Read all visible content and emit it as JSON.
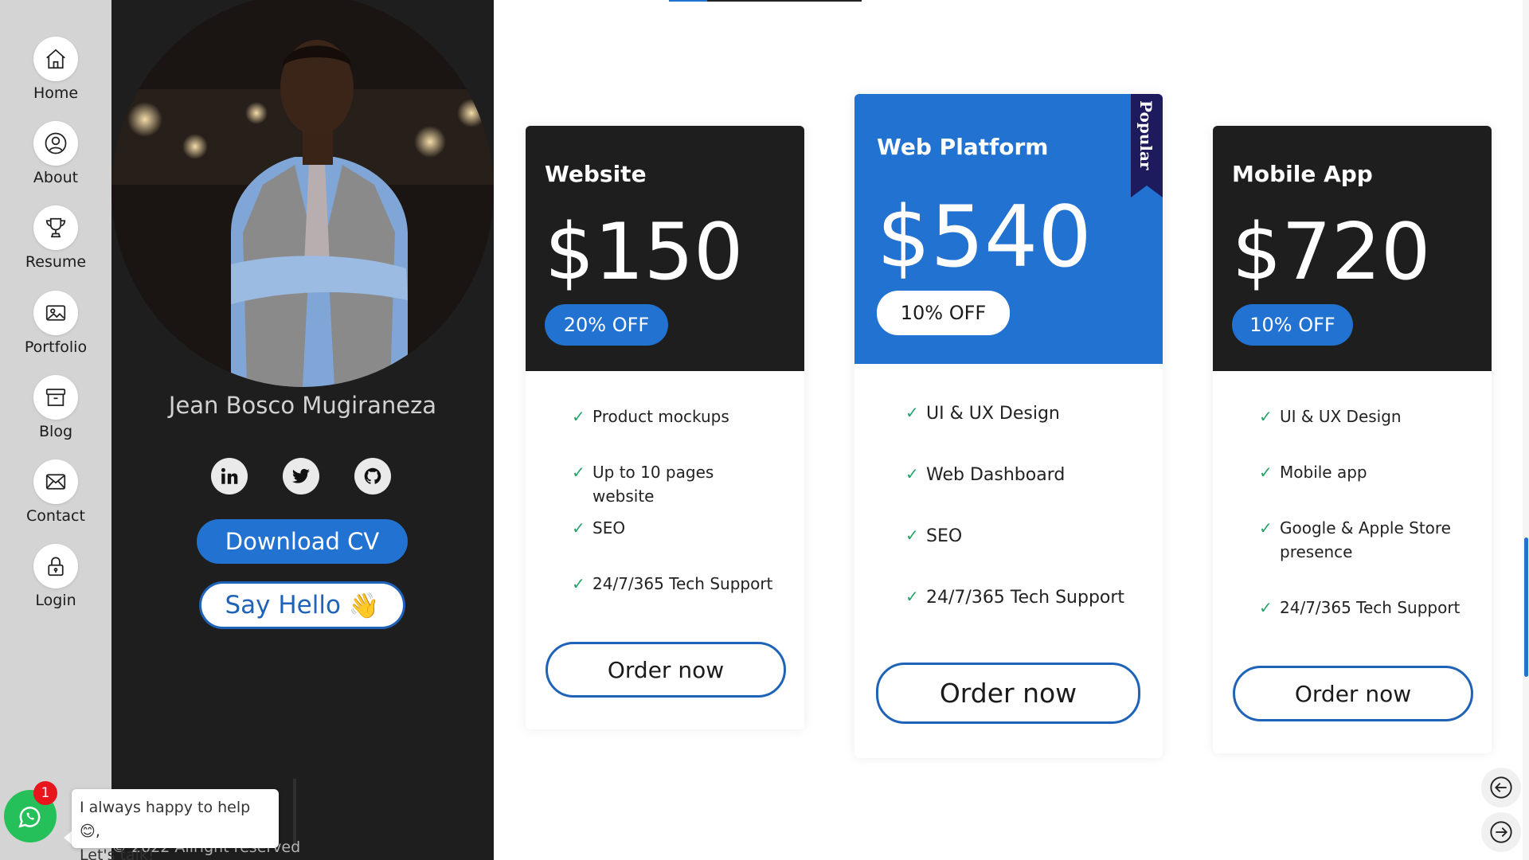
{
  "nav": {
    "items": [
      {
        "label": "Home",
        "icon": "home-icon"
      },
      {
        "label": "About",
        "icon": "user-icon"
      },
      {
        "label": "Resume",
        "icon": "trophy-icon"
      },
      {
        "label": "Portfolio",
        "icon": "image-icon"
      },
      {
        "label": "Blog",
        "icon": "archive-icon"
      },
      {
        "label": "Contact",
        "icon": "mail-icon"
      },
      {
        "label": "Login",
        "icon": "lock-icon"
      }
    ]
  },
  "profile": {
    "name": "Jean Bosco Mugiraneza",
    "socials": [
      {
        "name": "linkedin",
        "icon": "linkedin-icon"
      },
      {
        "name": "twitter",
        "icon": "twitter-icon"
      },
      {
        "name": "github",
        "icon": "github-icon"
      }
    ],
    "download_cv_label": "Download CV",
    "say_hello_label": "Say Hello",
    "say_hello_emoji": "👋",
    "copyright": "© 2022 Allright reserved"
  },
  "pricing": {
    "plans": [
      {
        "title": "Website",
        "price": "$150",
        "discount": "20% OFF",
        "features": [
          "Product mockups",
          "Up to 10 pages website",
          "SEO",
          "24/7/365 Tech Support"
        ],
        "cta": "Order now"
      },
      {
        "title": "Web Platform",
        "price": "$540",
        "discount": "10% OFF",
        "ribbon": "Popular",
        "features": [
          "UI & UX Design",
          "Web Dashboard",
          "SEO",
          "24/7/365 Tech Support"
        ],
        "cta": "Order now"
      },
      {
        "title": "Mobile App",
        "price": "$720",
        "discount": "10% OFF",
        "features": [
          "UI & UX Design",
          "Mobile app",
          "Google & Apple Store presence",
          "24/7/365 Tech Support"
        ],
        "cta": "Order now"
      }
    ]
  },
  "chat": {
    "badge_count": "1",
    "message_line1": "I always happy to help",
    "message_emoji": "😊",
    "message_line2": "Let's talk!"
  },
  "colors": {
    "accent": "#2272d2",
    "dark": "#1e1e1e",
    "check": "#27a26b",
    "whatsapp": "#25c05a",
    "ribbon": "#1d1a5e"
  }
}
